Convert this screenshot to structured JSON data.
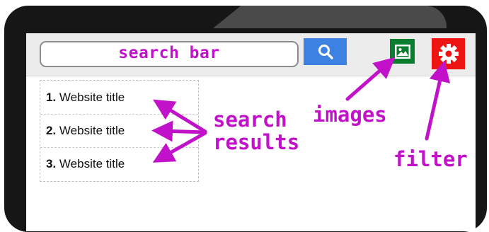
{
  "search": {
    "label": "search bar"
  },
  "results": [
    {
      "number": "1.",
      "title": "Website title"
    },
    {
      "number": "2.",
      "title": "Website title"
    },
    {
      "number": "3.",
      "title": "Website title"
    }
  ],
  "annotations": {
    "search_results_line1": "search",
    "search_results_line2": "results",
    "images": "images",
    "filter": "filter"
  },
  "icons": {
    "search": "search-icon",
    "images": "image-icon",
    "filter": "gear-icon"
  },
  "colors": {
    "annotation": "#c112c9",
    "search_button": "#3d82e3",
    "images_button": "#0a7d2e",
    "filter_button": "#ef1414",
    "device_frame": "#161616"
  }
}
